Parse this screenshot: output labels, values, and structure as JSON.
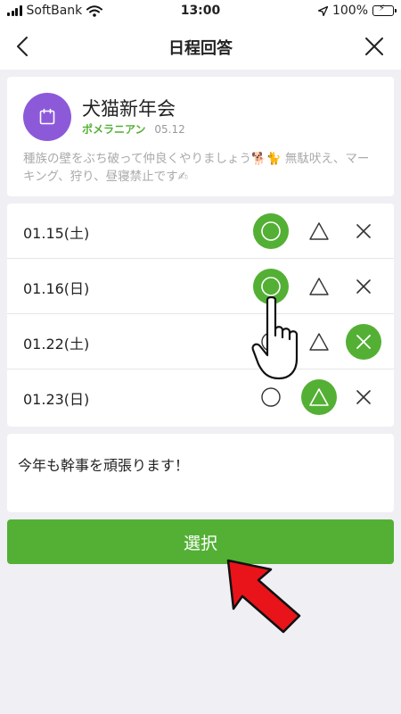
{
  "status_bar": {
    "carrier": "SoftBank",
    "time": "13:00",
    "battery": "100%"
  },
  "nav": {
    "title": "日程回答",
    "back_icon": "chevron-left-icon",
    "close_icon": "close-icon"
  },
  "event": {
    "title": "犬猫新年会",
    "organizer": "ポメラニアン",
    "created": "05.12",
    "description": "種族の壁をぶち破って仲良くやりましょう🐕🐈 無駄吠え、マーキング、狩り、昼寝禁止です✍",
    "icon": "calendar-icon",
    "color": "#8c5ad9"
  },
  "dates": [
    {
      "label": "01.15(土)",
      "selected": "o"
    },
    {
      "label": "01.16(日)",
      "selected": "o"
    },
    {
      "label": "01.22(土)",
      "selected": "x"
    },
    {
      "label": "01.23(日)",
      "selected": "t"
    }
  ],
  "comment": "今年も幹事を頑張ります！",
  "select_label": "選択",
  "colors": {
    "accent": "#53b034",
    "background": "#efeff4",
    "annotation_arrow": "#e8141a"
  }
}
